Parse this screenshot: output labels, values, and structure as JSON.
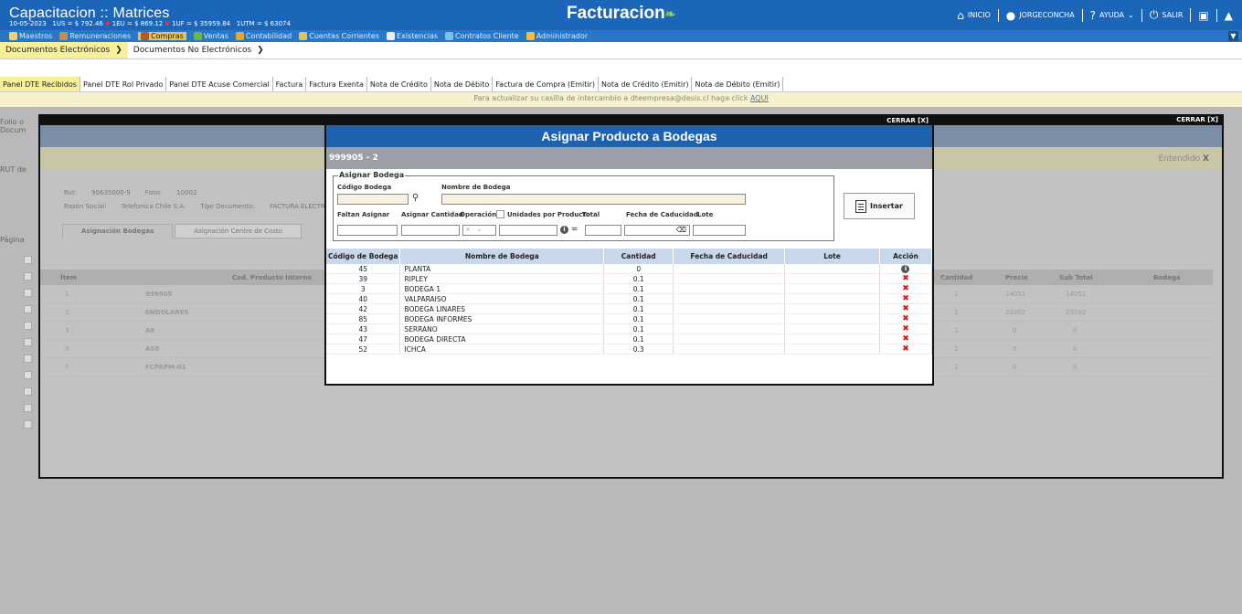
{
  "header": {
    "company": "Capacitacion  :: Matrices",
    "date": "10-05-2023",
    "us": "1US = $ 792.46",
    "eu": "1EU = $ 869.12",
    "uf": "1UF = $ 35959.84",
    "utm": "1UTM = $ 63074",
    "app_title": "Facturacion",
    "links": {
      "inicio": "INICIO",
      "user": "JORGECONCHA",
      "ayuda": "AYUDA",
      "salir": "SALIR"
    }
  },
  "menu": {
    "items": [
      "Maestros",
      "Remuneraciones",
      "Compras",
      "Ventas",
      "Contabilidad",
      "Cuentas Corrientes",
      "Existencias",
      "Contratos Cliente",
      "Administrador"
    ]
  },
  "breadcrumb": {
    "items": [
      "Documentos Electrónicos",
      "Documentos No Electrónicos"
    ]
  },
  "tabs": [
    "Panel DTE Recibidos",
    "Panel DTE Rol Privado",
    "Panel DTE Acuse Comercial",
    "Factura",
    "Factura Exenta",
    "Nota de Crédito",
    "Nota de Débito",
    "Factura de Compra (Emitir)",
    "Nota de Crédito (Emitir)",
    "Nota de Débito (Emitir)"
  ],
  "notice": {
    "text": "Para actualizar su casilla de intercambio a dteempresa@desis.cl haga click ",
    "link": "AQUI"
  },
  "side": {
    "folio": "Folio o",
    "docum": "Docum",
    "rut": "RUT de",
    "pagina": "Página"
  },
  "back_modal": {
    "close": "CERRAR [X]",
    "entendido": "Entendido",
    "entendido_x": "X",
    "rut_label": "Rut:",
    "rut_value": "90635000-9",
    "folio_label": "Folio:",
    "folio_value": "10002",
    "razon_label": "Razón Social:",
    "razon_value": "Telefonica Chile S.A.",
    "tipo_label": "Tipo Documento:",
    "tipo_value": "FACTURA ELECTRONICA",
    "tab1": "Asignación Bodegas",
    "tab2": "Asignación Centro de Costo",
    "grid_headers": {
      "item": "Ítem",
      "cod": "Cod. Producto Interno",
      "cantidad": "Cantidad",
      "precio": "Precio",
      "subtotal": "Sub Total",
      "bodega": "Bodega"
    },
    "rows": [
      {
        "item": "1",
        "cod": "999905",
        "cantidad": "1",
        "precio": "14051",
        "subtotal": "14051"
      },
      {
        "item": "2",
        "cod": "ENDOLARES",
        "cantidad": "1",
        "precio": "23202",
        "subtotal": "23202"
      },
      {
        "item": "3",
        "cod": "A8",
        "cantidad": "1",
        "precio": "0",
        "subtotal": "0"
      },
      {
        "item": "4",
        "cod": "A58",
        "cantidad": "1",
        "precio": "0",
        "subtotal": "0"
      },
      {
        "item": "5",
        "cod": "FCPAPM-01",
        "cantidad": "1",
        "precio": "0",
        "subtotal": "0"
      }
    ]
  },
  "modal": {
    "close": "CERRAR [X]",
    "title": "Asignar Producto a Bodegas",
    "code": "999905 - 2",
    "legend": "Asignar Bodega",
    "labels": {
      "codigo_bodega": "Código Bodega",
      "nombre_bodega": "Nombre de Bodega",
      "faltan_asignar": "Faltan Asignar",
      "asignar_cantidad": "Asignar Cantidad",
      "operacion": "Operación",
      "unidades_por_producto": "Unidades por Producto",
      "total": "Total",
      "fecha_caducidad": "Fecha de Caducidad",
      "lote": "Lote"
    },
    "insert_label": "Insertar",
    "table": {
      "headers": [
        "Código de Bodega",
        "Nombre de Bodega",
        "Cantidad",
        "Fecha de Caducidad",
        "Lote",
        "Acción"
      ],
      "rows": [
        {
          "codigo": "45",
          "nombre": "PLANTA",
          "cantidad": "0",
          "accion": "info"
        },
        {
          "codigo": "39",
          "nombre": "RIPLEY",
          "cantidad": "0.1",
          "accion": "delete"
        },
        {
          "codigo": "3",
          "nombre": "BODEGA 1",
          "cantidad": "0.1",
          "accion": "delete"
        },
        {
          "codigo": "40",
          "nombre": "VALPARAISO",
          "cantidad": "0.1",
          "accion": "delete"
        },
        {
          "codigo": "42",
          "nombre": "BODEGA LINARES",
          "cantidad": "0.1",
          "accion": "delete"
        },
        {
          "codigo": "85",
          "nombre": "BODEGA INFORMES",
          "cantidad": "0.1",
          "accion": "delete"
        },
        {
          "codigo": "43",
          "nombre": "SERRANO",
          "cantidad": "0.1",
          "accion": "delete"
        },
        {
          "codigo": "47",
          "nombre": "BODEGA DIRECTA",
          "cantidad": "0.1",
          "accion": "delete"
        },
        {
          "codigo": "52",
          "nombre": "ICHCA",
          "cantidad": "0.3",
          "accion": "delete"
        }
      ]
    }
  },
  "colors": {
    "header_blue": "#1b66b8",
    "modal_title": "#1e62ad",
    "delete_red": "#d11111",
    "active_tab": "#f7f099"
  }
}
